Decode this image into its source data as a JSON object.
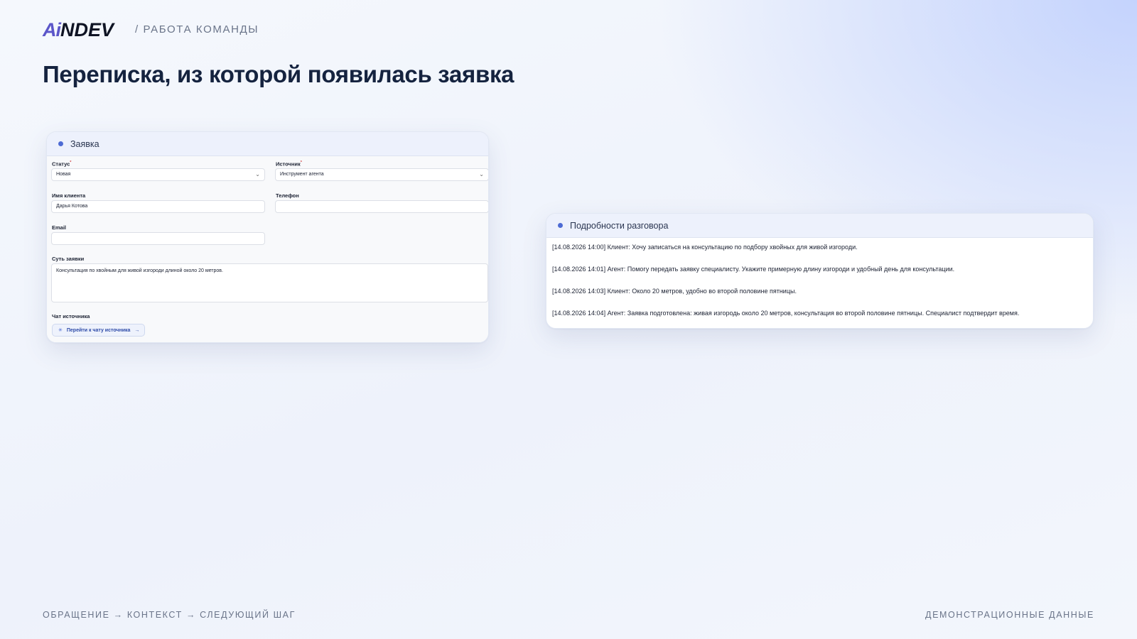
{
  "header": {
    "logo_accent": "Ai",
    "logo_rest": "NDEV",
    "section": "/ РАБОТА КОМАНДЫ"
  },
  "page_title": "Переписка, из которой появилась заявка",
  "form_card": {
    "title": "Заявка",
    "status_label": "Статус",
    "status_value": "Новая",
    "source_label": "Источник",
    "source_value": "Инструмент агента",
    "client_label": "Имя клиента",
    "client_value": "Дарья Котова",
    "phone_label": "Телефон",
    "phone_value": "",
    "email_label": "Email",
    "email_value": "",
    "essence_label": "Суть заявки",
    "essence_value": "Консультация по хвойным для живой изгороди длиной около 20 метров.",
    "chat_label": "Чат источника",
    "chat_button": "Перейти к чату источника",
    "required_mark": "*",
    "chevron": "⌄",
    "arrow": "→"
  },
  "conv_card": {
    "title": "Подробности разговора",
    "messages": [
      "[14.08.2026 14:00] Клиент: Хочу записаться на консультацию по подбору хвойных для живой изгороди.",
      "[14.08.2026 14:01] Агент: Помогу передать заявку специалисту. Укажите примерную длину изгороди и удобный день для консультации.",
      "[14.08.2026 14:03] Клиент: Около 20 метров, удобно во второй половине пятницы.",
      "[14.08.2026 14:04] Агент: Заявка подготовлена: живая изгородь около 20 метров, консультация во второй половине пятницы. Специалист подтвердит время."
    ]
  },
  "footer": {
    "left": "ОБРАЩЕНИЕ → КОНТЕКСТ → СЛЕДУЮЩИЙ ШАГ",
    "right": "ДЕМОНСТРАЦИОННЫЕ ДАННЫЕ"
  },
  "colors": {
    "accent": "#5b56c9",
    "dot": "#4d6bd4",
    "title": "#15233f"
  }
}
